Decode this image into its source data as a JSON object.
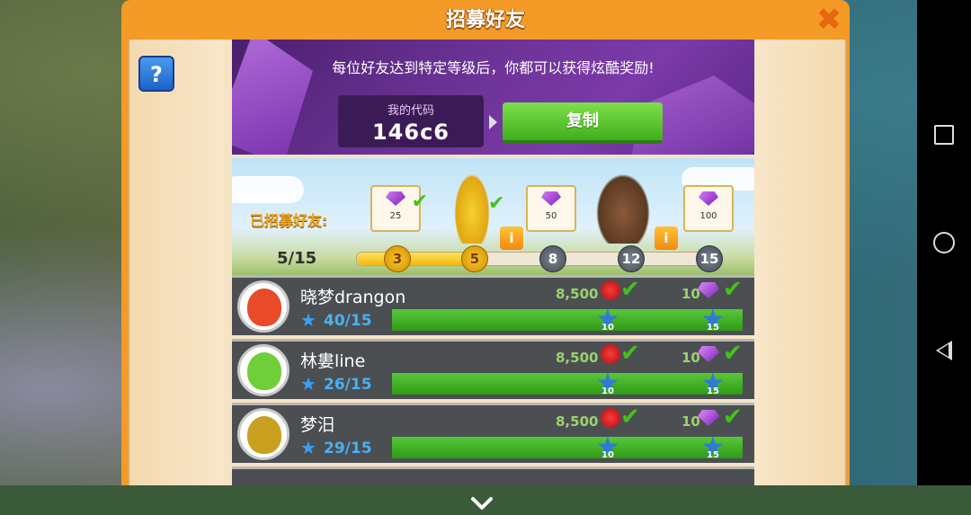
{
  "dialog": {
    "title": "招募好友",
    "help_label": "?",
    "close_label": "✖"
  },
  "banner": {
    "message": "每位好友达到特定等级后，你都可以获得炫酷奖励!",
    "code_label": "我的代码",
    "code_value": "146c6",
    "copy_button": "复制"
  },
  "progress": {
    "recruited_label": "已招募好友:",
    "count": "5/15",
    "current": 5,
    "max": 15,
    "milestones": [
      "3",
      "5",
      "8",
      "12",
      "15"
    ],
    "milestones_reached": 2,
    "rewards": [
      "25",
      "50",
      "100"
    ],
    "info_label": "i"
  },
  "friends": [
    {
      "name": "晓梦drangon",
      "level": "40/15",
      "val1": "8,500",
      "val2": "10",
      "badge1": "10",
      "badge2": "15",
      "avatar_color": "#e84a2a"
    },
    {
      "name": "林婁line",
      "level": "26/15",
      "val1": "8,500",
      "val2": "10",
      "badge1": "10",
      "badge2": "15",
      "avatar_color": "#6fcf3a"
    },
    {
      "name": "梦汨",
      "level": "29/15",
      "val1": "8,500",
      "val2": "10",
      "badge1": "10",
      "badge2": "15",
      "avatar_color": "#c9a020"
    }
  ],
  "colors": {
    "panel": "#f39a27",
    "copy_button": "#4bbf22",
    "row_bar": "#45b526",
    "banner": "#6a3294"
  }
}
